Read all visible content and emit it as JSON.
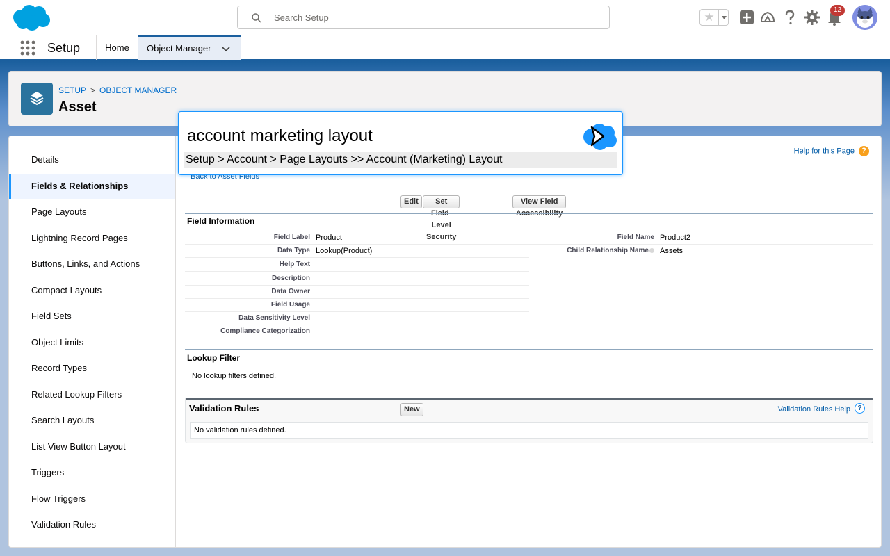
{
  "colors": {
    "brand_blue": "#1b5f9e",
    "accent": "#1b96ff",
    "link": "#015ba7",
    "notification_red": "#c23934",
    "help_orange": "#f8a01c",
    "object_icon": "#2a739e"
  },
  "header": {
    "logo_icon": "salesforce-cloud-logo",
    "search_placeholder": "Search Setup",
    "notification_count": "12"
  },
  "context_bar": {
    "app_name": "Setup",
    "tabs": [
      {
        "label": "Home"
      },
      {
        "label": "Object Manager"
      }
    ]
  },
  "object_header": {
    "breadcrumb": [
      "SETUP",
      "OBJECT MANAGER"
    ],
    "separator": ">",
    "title": "Asset"
  },
  "sidebar": {
    "items": [
      {
        "label": "Details"
      },
      {
        "label": "Fields & Relationships"
      },
      {
        "label": "Page Layouts"
      },
      {
        "label": "Lightning Record Pages"
      },
      {
        "label": "Buttons, Links, and Actions"
      },
      {
        "label": "Compact Layouts"
      },
      {
        "label": "Field Sets"
      },
      {
        "label": "Object Limits"
      },
      {
        "label": "Record Types"
      },
      {
        "label": "Related Lookup Filters"
      },
      {
        "label": "Search Layouts"
      },
      {
        "label": "List View Button Layout"
      },
      {
        "label": "Triggers"
      },
      {
        "label": "Flow Triggers"
      },
      {
        "label": "Validation Rules"
      }
    ],
    "active": "Fields & Relationships"
  },
  "content": {
    "help_link": "Help for this Page",
    "back_link": "Back to Asset Fields",
    "buttons": {
      "edit": "Edit",
      "fls": "Set Field-Level Security",
      "accessibility": "View Field Accessibility"
    },
    "field_info": {
      "title": "Field Information",
      "left": [
        {
          "label": "Field Label",
          "value": "Product"
        },
        {
          "label": "Data Type",
          "value": "Lookup(Product)"
        },
        {
          "label": "Help Text",
          "value": ""
        },
        {
          "label": "Description",
          "value": ""
        },
        {
          "label": "Data Owner",
          "value": ""
        },
        {
          "label": "Field Usage",
          "value": ""
        },
        {
          "label": "Data Sensitivity Level",
          "value": ""
        },
        {
          "label": "Compliance Categorization",
          "value": ""
        }
      ],
      "right": [
        {
          "label": "Field Name",
          "value": "Product2"
        },
        {
          "label": "Child Relationship Name",
          "value": "Assets"
        }
      ]
    },
    "lookup_filter": {
      "title": "Lookup Filter",
      "empty": "No lookup filters defined."
    },
    "validation_rules": {
      "title": "Validation Rules",
      "new_button": "New",
      "help": "Validation Rules Help",
      "help_icon_text": "?",
      "empty": "No validation rules defined."
    }
  },
  "overlay": {
    "query": "account marketing layout",
    "result": "Setup > Account > Page Layouts >> Account (Marketing) Layout"
  }
}
